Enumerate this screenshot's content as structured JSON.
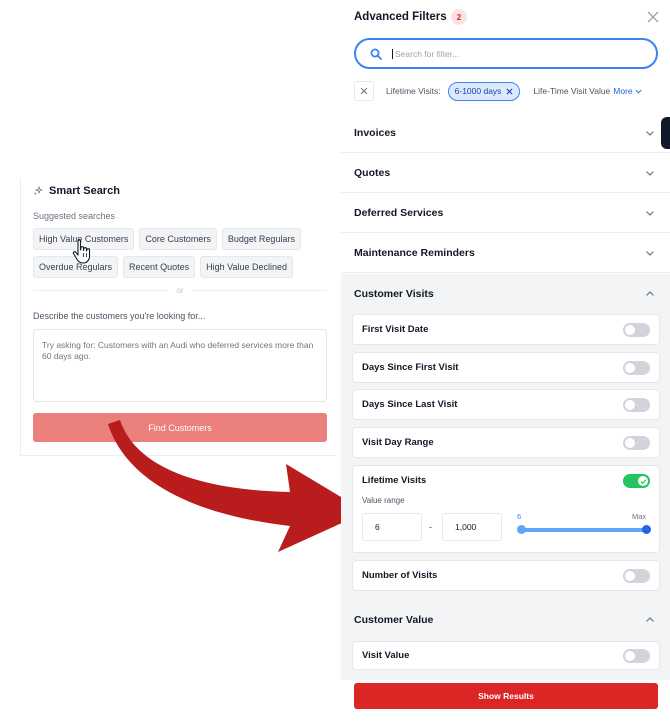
{
  "smart_search": {
    "title": "Smart Search",
    "suggested_label": "Suggested searches",
    "suggestions": [
      {
        "label": "High Value Customers"
      },
      {
        "label": "Core Customers"
      },
      {
        "label": "Budget Regulars"
      },
      {
        "label": "Overdue Regulars"
      },
      {
        "label": "Recent Quotes"
      },
      {
        "label": "High Value Declined"
      }
    ],
    "or_label": "or",
    "describe_label": "Describe the customers you're looking for...",
    "textarea_placeholder": "Try asking for: Customers with an Audi who deferred services more than 60 days ago.",
    "find_button": "Find Customers"
  },
  "panel": {
    "title": "Advanced Filters",
    "badge_count": "2",
    "search_placeholder": "Search for filter...",
    "active_filters": {
      "lifetime_visits_label": "Lifetime Visits:",
      "lifetime_visits_value": "6-1000 days",
      "lifetime_value_label": "Life-Time Visit Value",
      "more_label": "More"
    },
    "sections": {
      "invoices": "Invoices",
      "quotes": "Quotes",
      "deferred_services": "Deferred Services",
      "maintenance_reminders": "Maintenance Reminders",
      "customer_visits": "Customer Visits",
      "customer_value": "Customer Value"
    },
    "visit_items": [
      {
        "label": "First Visit Date",
        "enabled": false
      },
      {
        "label": "Days Since First Visit",
        "enabled": false
      },
      {
        "label": "Days Since Last Visit",
        "enabled": false
      },
      {
        "label": "Visit Day Range",
        "enabled": false
      },
      {
        "label": "Lifetime Visits",
        "enabled": true
      },
      {
        "label": "Number of Visits",
        "enabled": false
      }
    ],
    "value_range": {
      "label": "Value range",
      "min_value": "6",
      "max_value": "1,000",
      "slider_min_label": "6",
      "slider_max_label": "Max",
      "dash": "-"
    },
    "value_items": [
      {
        "label": "Visit Value",
        "enabled": false
      }
    ],
    "show_results": "Show Results"
  },
  "colors": {
    "accent_blue": "#3b82f6",
    "brand_red": "#dc2626",
    "find_button_red": "#ea7f7c",
    "arrow_red": "#b91c1c",
    "toggle_on": "#22c55e"
  }
}
